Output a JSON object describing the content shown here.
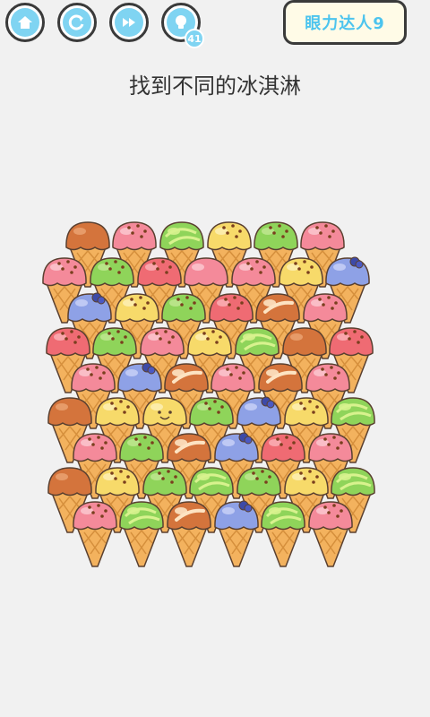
{
  "top_bar": {
    "home_icon": "home-icon",
    "restart_icon": "restart-icon",
    "skip_icon": "skip-icon",
    "hint_icon": "lightbulb-icon",
    "hint_count": "41",
    "level_label": "眼力达人9"
  },
  "puzzle": {
    "instruction": "找到不同的冰淇淋"
  },
  "colors": {
    "accent": "#7fd4f2",
    "pink": "#f48a9a",
    "green": "#8fd45a",
    "yellow": "#f7da6a",
    "caramel": "#d4743c",
    "blue": "#8ea1e6",
    "cone": "#f3b25e"
  },
  "flavor_legend": {
    "pink_sprinkle": "pink ice cream with chocolate sprinkles",
    "green_swirl": "lime green swirl",
    "green_sprinkle": "green ice cream with sprinkles",
    "yellow_sprinkle": "lemon ice cream with sprinkles",
    "yellow_face": "lemon ice cream with face (the odd one)",
    "caramel_plain": "caramel",
    "caramel_stripe": "caramel with cream stripe",
    "blue_berry": "blue ice cream with blueberry",
    "red_sprinkle": "red ice cream with sprinkles",
    "pink_plain": "pink ice cream"
  }
}
